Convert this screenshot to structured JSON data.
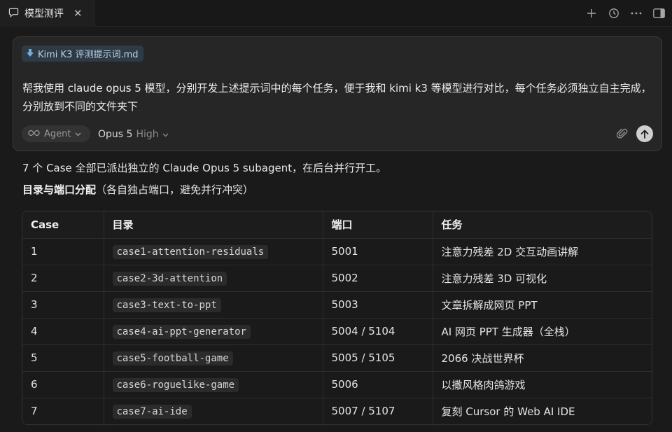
{
  "tab": {
    "title": "模型测评",
    "close": "✕"
  },
  "toolbar": {
    "icons": [
      "plus-icon",
      "history-icon",
      "more-icon",
      "panel-toggle-icon"
    ]
  },
  "composer": {
    "attachment": {
      "label": "Kimi K3 评测提示词.md",
      "icon": "download-arrow-icon"
    },
    "prompt": "帮我使用 claude opus 5 模型，分别开发上述提示词中的每个任务，便于我和 kimi k3 等模型进行对比，每个任务必须独立自主完成，分别放到不同的文件夹下",
    "mode": "Agent",
    "model": "Opus 5",
    "effort": "High"
  },
  "response": {
    "summary": "7 个 Case 全部已派出独立的 Claude Opus 5 subagent，在后台并行开工。",
    "heading_strong": "目录与端口分配",
    "heading_note": "（各自独占端口，避免并行冲突）"
  },
  "table": {
    "headers": [
      "Case",
      "目录",
      "端口",
      "任务"
    ],
    "rows": [
      {
        "case": "1",
        "dir": "case1-attention-residuals",
        "port": "5001",
        "task": "注意力残差 2D 交互动画讲解"
      },
      {
        "case": "2",
        "dir": "case2-3d-attention",
        "port": "5002",
        "task": "注意力残差 3D 可视化"
      },
      {
        "case": "3",
        "dir": "case3-text-to-ppt",
        "port": "5003",
        "task": "文章拆解成网页 PPT"
      },
      {
        "case": "4",
        "dir": "case4-ai-ppt-generator",
        "port": "5004 / 5104",
        "task": "AI 网页 PPT 生成器（全栈）"
      },
      {
        "case": "5",
        "dir": "case5-football-game",
        "port": "5005 / 5105",
        "task": "2066 决战世界杯"
      },
      {
        "case": "6",
        "dir": "case6-roguelike-game",
        "port": "5006",
        "task": "以撒风格肉鸽游戏"
      },
      {
        "case": "7",
        "dir": "case7-ai-ide",
        "port": "5007 / 5107",
        "task": "复刻 Cursor 的 Web AI IDE"
      }
    ]
  },
  "colors": {
    "background": "#1a1a1a",
    "composer": "#262626",
    "chip": "#2f3b44",
    "accent_text": "#b7d3ea"
  }
}
